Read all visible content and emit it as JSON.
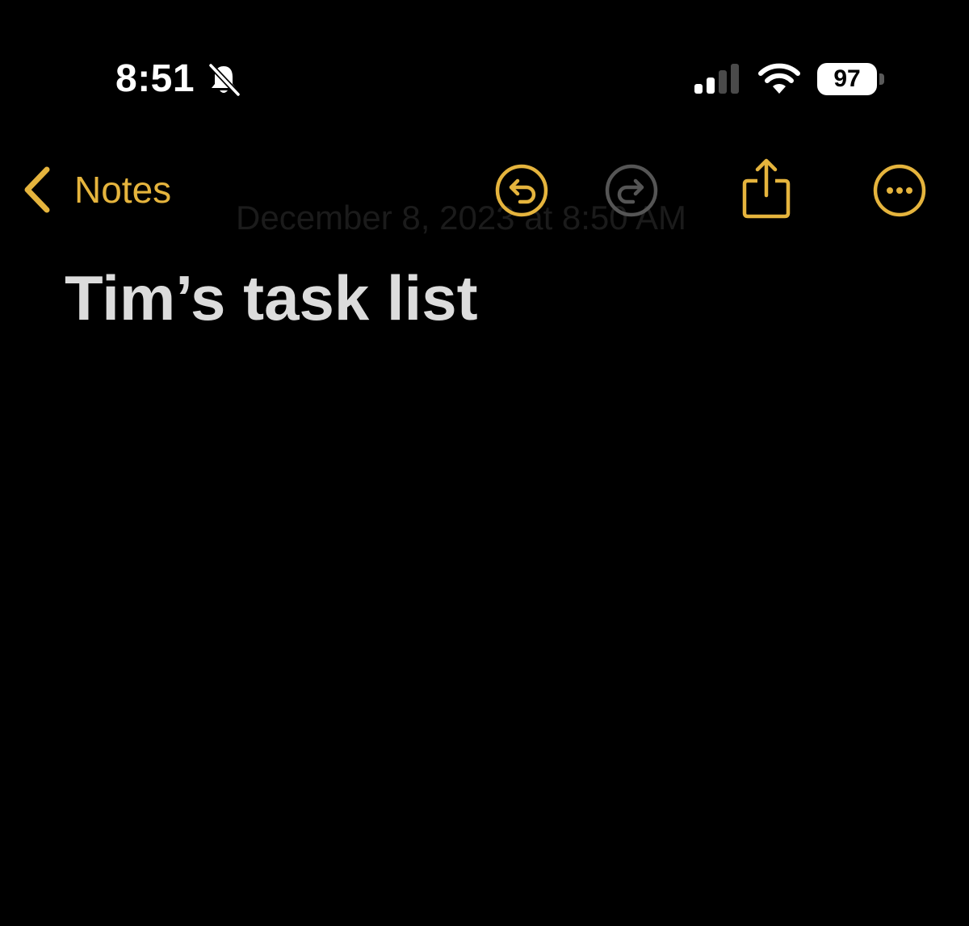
{
  "status_bar": {
    "time": "8:51",
    "battery_percent": "97",
    "silent_mode": true,
    "signal_bars_filled": 2,
    "signal_bars_total": 4,
    "icons": [
      "bell-slash-icon",
      "signal-icon",
      "wifi-icon",
      "battery-icon"
    ]
  },
  "nav": {
    "back_label": "Notes",
    "buttons": [
      "undo-icon",
      "redo-icon",
      "share-icon",
      "more-icon"
    ],
    "redo_enabled": false
  },
  "note": {
    "date": "December 8, 2023 at 8:50 AM",
    "title": "Tim’s task list"
  },
  "colors": {
    "accent": "#E5B43D",
    "background": "#000000",
    "title_text": "#dcdcdc",
    "disabled": "#555555"
  }
}
